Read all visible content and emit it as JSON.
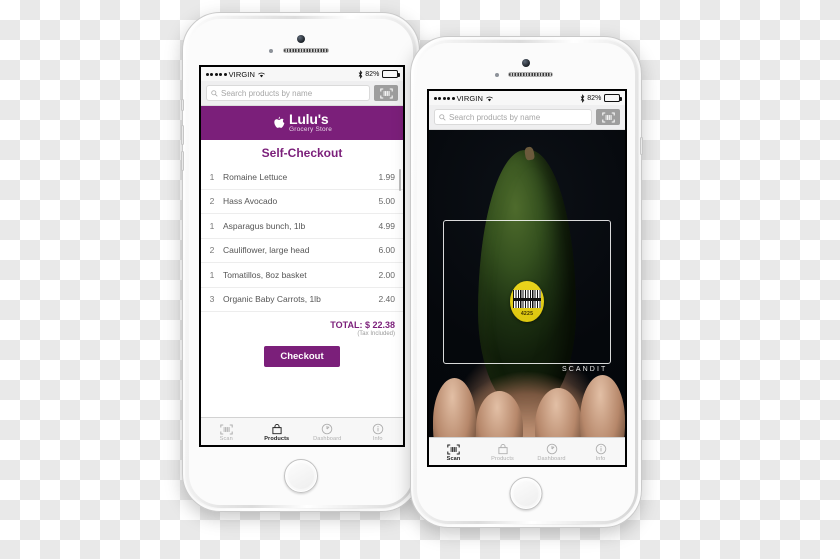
{
  "scene": {
    "description": "Two white iPhones showing a grocery self-checkout app and a barcode scanning camera view"
  },
  "status_bar": {
    "signal_dots": 5,
    "carrier": "VIRGIN",
    "wifi_icon": "wifi-icon",
    "bluetooth_icon": "bluetooth-icon",
    "battery_percent": "82%",
    "battery_level": 82,
    "charging_icon": "charging-bolt-icon"
  },
  "search": {
    "placeholder": "Search products by name",
    "search_icon": "search-icon",
    "scan_button_icon": "barcode-scan-icon"
  },
  "store_header": {
    "logo_icon": "apple-fruit-icon",
    "name": "Lulu's",
    "tagline": "Grocery Store",
    "background_color": "#7B1F7A"
  },
  "checkout": {
    "title": "Self-Checkout",
    "columns": [
      "qty",
      "name",
      "price"
    ],
    "items": [
      {
        "qty": "1",
        "name": "Romaine Lettuce",
        "price": "1.99"
      },
      {
        "qty": "2",
        "name": "Hass Avocado",
        "price": "5.00"
      },
      {
        "qty": "1",
        "name": "Asparagus bunch, 1lb",
        "price": "4.99"
      },
      {
        "qty": "2",
        "name": "Cauliflower, large head",
        "price": "6.00"
      },
      {
        "qty": "1",
        "name": "Tomatillos, 8oz basket",
        "price": "2.00"
      },
      {
        "qty": "3",
        "name": "Organic Baby Carrots, 1lb",
        "price": "2.40"
      }
    ],
    "total_label": "TOTAL:",
    "total_value": "$ 22.38",
    "tax_note": "(Tax Included)",
    "checkout_button": "Checkout",
    "accent_color": "#7B1F7A"
  },
  "tabs_left": [
    {
      "label": "Scan",
      "icon": "barcode-scan-icon",
      "active": false
    },
    {
      "label": "Products",
      "icon": "shopping-bag-icon",
      "active": true
    },
    {
      "label": "Dashboard",
      "icon": "gauge-icon",
      "active": false
    },
    {
      "label": "Info",
      "icon": "info-circle-icon",
      "active": false
    }
  ],
  "tabs_right": [
    {
      "label": "Scan",
      "icon": "barcode-scan-icon",
      "active": true
    },
    {
      "label": "Products",
      "icon": "shopping-bag-icon",
      "active": false
    },
    {
      "label": "Dashboard",
      "icon": "gauge-icon",
      "active": false
    },
    {
      "label": "Info",
      "icon": "info-circle-icon",
      "active": false
    }
  ],
  "scanner": {
    "subject": "avocado held in a hand",
    "viewfinder": "scan-frame",
    "watermark": "SCANDIT",
    "plu_code": "4225"
  }
}
